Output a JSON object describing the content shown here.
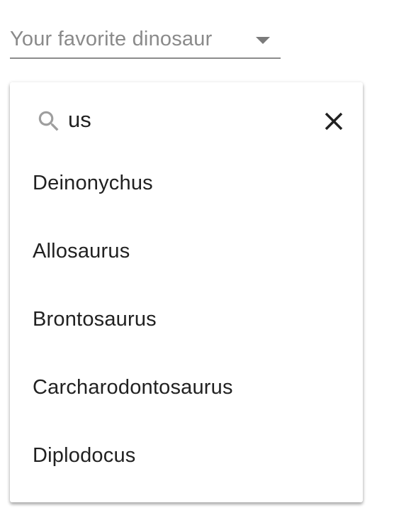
{
  "select": {
    "placeholder": "Your favorite dinosaur",
    "arrow_icon": "dropdown-arrow-icon"
  },
  "search": {
    "value": "us",
    "search_icon": "search-icon",
    "clear_icon": "close-icon"
  },
  "options": [
    {
      "label": "Deinonychus"
    },
    {
      "label": "Allosaurus"
    },
    {
      "label": "Brontosaurus"
    },
    {
      "label": "Carcharodontosaurus"
    },
    {
      "label": "Diplodocus"
    }
  ],
  "colors": {
    "text": "#212121",
    "placeholder": "#8a8a8a",
    "underline": "#8c8c8c",
    "icon_gray": "#9e9e9e"
  }
}
